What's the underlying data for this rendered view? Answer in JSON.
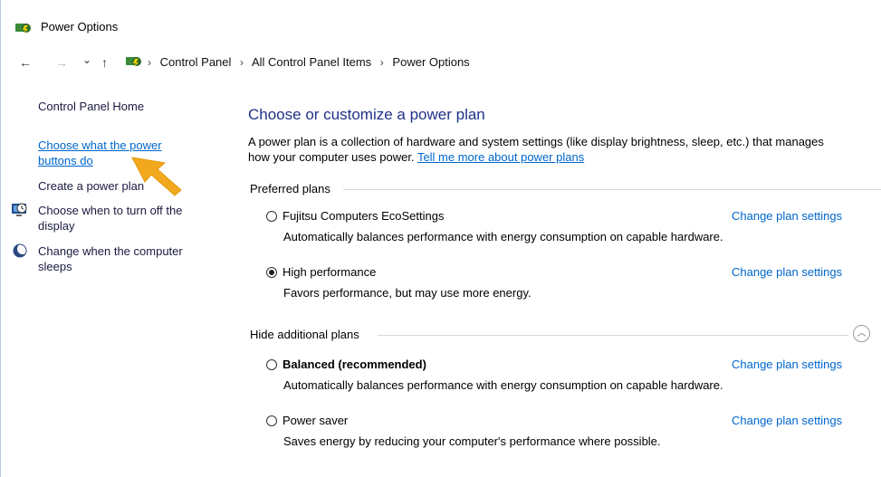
{
  "window": {
    "title": "Power Options"
  },
  "nav": {
    "back": "←",
    "forward": "→",
    "dropdown": "⌄",
    "up": "↑",
    "breadcrumbs": [
      "Control Panel",
      "All Control Panel Items",
      "Power Options"
    ],
    "separator": "›"
  },
  "sidebar": {
    "home": "Control Panel Home",
    "links": [
      {
        "label_line1": "Choose what the power",
        "label_line2": "buttons do"
      },
      {
        "label": "Create a power plan"
      },
      {
        "label_line1": "Choose when to turn off the",
        "label_line2": "display"
      },
      {
        "label_line1": "Change when the computer",
        "label_line2": "sleeps"
      }
    ]
  },
  "main": {
    "heading": "Choose or customize a power plan",
    "intro_line1": "A power plan is a collection of hardware and system settings (like display brightness, sleep, etc.) that manages",
    "intro_line2": "how your computer uses power.",
    "intro_link": "Tell me more about power plans",
    "preferred_label": "Preferred plans",
    "hide_label": "Hide additional plans",
    "collapse_glyph": "︿",
    "change_label": "Change plan settings",
    "plans": [
      {
        "name": "Fujitsu Computers EcoSettings",
        "desc": "Automatically balances performance with energy consumption on capable hardware.",
        "selected": false
      },
      {
        "name": "High performance",
        "desc": "Favors performance, but may use more energy.",
        "selected": true
      },
      {
        "name": "Balanced (recommended)",
        "desc": "Automatically balances performance with energy consumption on capable hardware.",
        "selected": false
      },
      {
        "name": "Power saver",
        "desc": "Saves energy by reducing your computer's performance where possible.",
        "selected": false
      }
    ]
  },
  "colors": {
    "link": "#0066cc",
    "heading": "#1e3287",
    "arrow": "#f2a81d"
  },
  "icons": [
    "power-options-icon",
    "monitor-clock-icon",
    "moon-icon",
    "annotation-arrow-icon"
  ]
}
